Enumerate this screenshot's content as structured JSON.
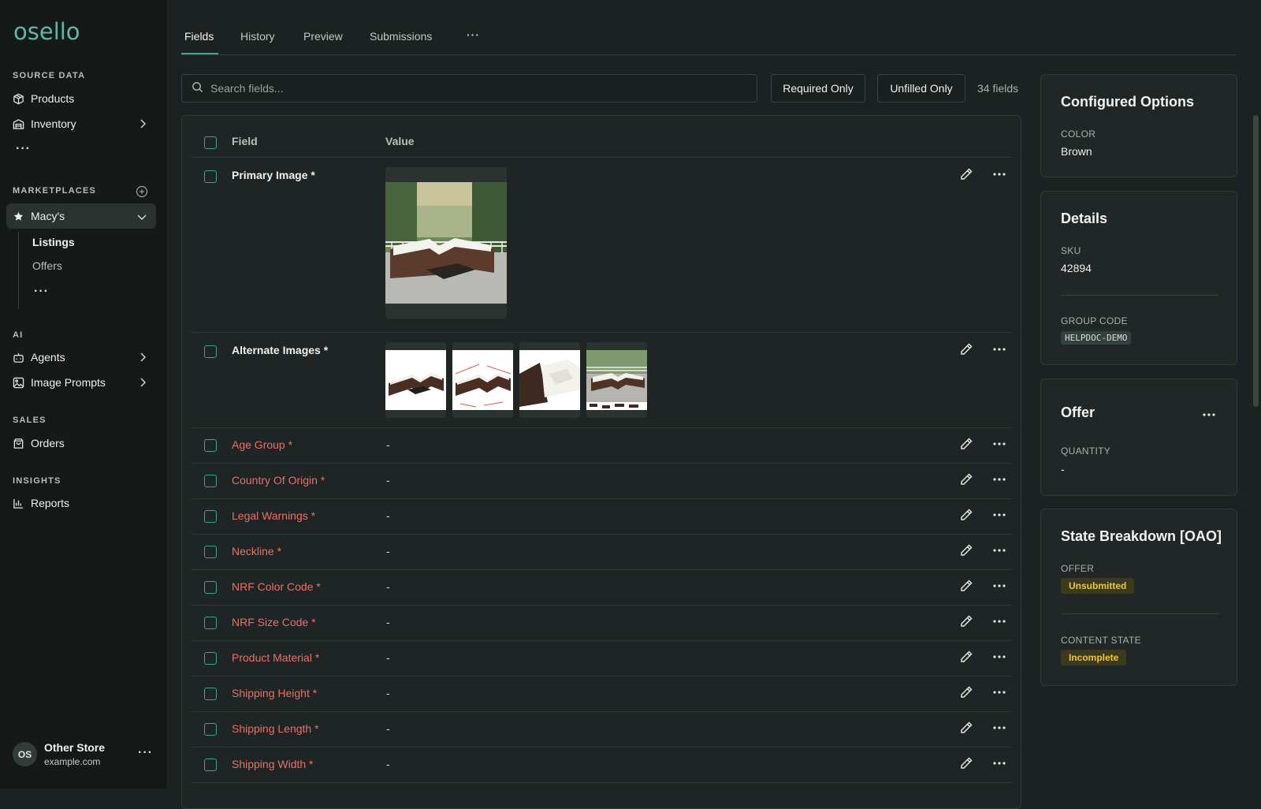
{
  "brand": {
    "logo_text": "osello"
  },
  "sidebar": {
    "sections": {
      "source_data": "SOURCE DATA",
      "marketplaces": "MARKETPLACES",
      "ai": "AI",
      "sales": "SALES",
      "insights": "INSIGHTS"
    },
    "products": "Products",
    "inventory": "Inventory",
    "marketplace": "Macy's",
    "listings": "Listings",
    "offers": "Offers",
    "agents": "Agents",
    "image_prompts": "Image Prompts",
    "orders": "Orders",
    "reports": "Reports",
    "more": "···"
  },
  "user": {
    "initials": "OS",
    "name": "Other Store",
    "domain": "example.com",
    "more": "···"
  },
  "tabs": [
    {
      "label": "Fields",
      "active": true
    },
    {
      "label": "History"
    },
    {
      "label": "Preview"
    },
    {
      "label": "Submissions"
    },
    {
      "label": "···"
    }
  ],
  "toolbar": {
    "search_placeholder": "Search fields...",
    "required_only": "Required Only",
    "unfilled_only": "Unfilled Only",
    "count": "34 fields"
  },
  "table": {
    "headers": {
      "field": "Field",
      "value": "Value"
    },
    "rows": [
      {
        "name": "Primary Image *",
        "value": ""
      },
      {
        "name": "Alternate Images *",
        "value": ""
      },
      {
        "name": "Age Group *",
        "value": "-"
      },
      {
        "name": "Country Of Origin *",
        "value": "-"
      },
      {
        "name": "Legal Warnings *",
        "value": "-"
      },
      {
        "name": "Neckline *",
        "value": "-"
      },
      {
        "name": "NRF Color Code *",
        "value": "-"
      },
      {
        "name": "NRF Size Code *",
        "value": "-"
      },
      {
        "name": "Product Material *",
        "value": "-"
      },
      {
        "name": "Shipping Height *",
        "value": "-"
      },
      {
        "name": "Shipping Length *",
        "value": "-"
      },
      {
        "name": "Shipping Width *",
        "value": "-"
      }
    ]
  },
  "panels": {
    "configured": {
      "title": "Configured Options",
      "color_label": "COLOR",
      "color_value": "Brown"
    },
    "details": {
      "title": "Details",
      "sku_label": "SKU",
      "sku_value": "42894",
      "group_label": "GROUP CODE",
      "group_value": "HELPDOC-DEMO"
    },
    "offer": {
      "title": "Offer",
      "more": "···",
      "quantity_label": "QUANTITY",
      "quantity_value": "-"
    },
    "state": {
      "title": "State Breakdown [OAO]",
      "offer_label": "OFFER",
      "offer_value": "Unsubmitted",
      "content_label": "CONTENT STATE",
      "content_value": "Incomplete"
    }
  },
  "colors": {
    "accent": "#3fa38f",
    "required": "#e8706a",
    "warning": "#f0c53a"
  }
}
